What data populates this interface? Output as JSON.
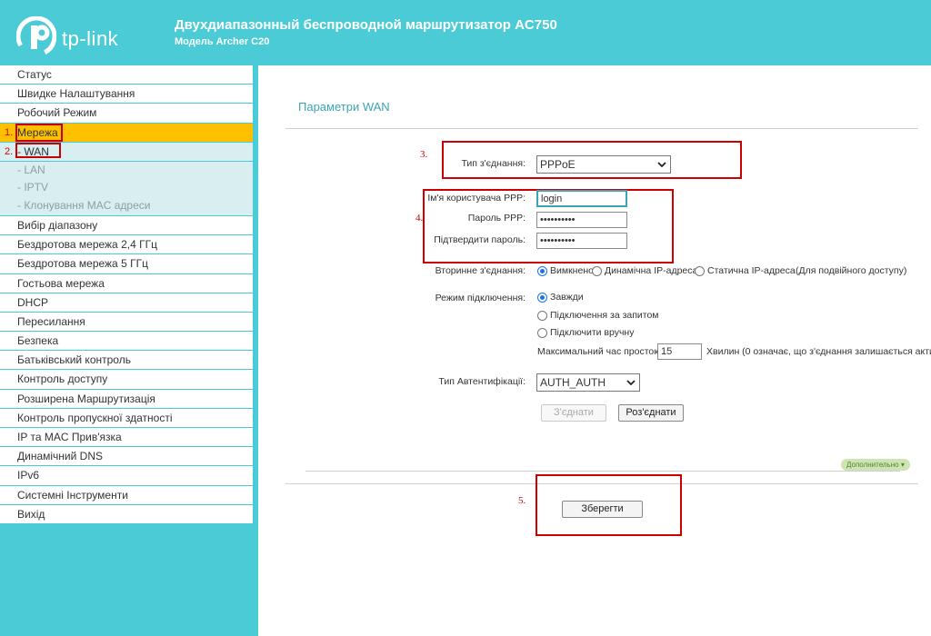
{
  "header": {
    "brand": "tp-link",
    "title": "Двухдиапазонный беспроводной маршрутизатор AC750",
    "model": "Модель Archer C20"
  },
  "sidebar": {
    "items": [
      {
        "label": "Статус"
      },
      {
        "label": "Швидке Налаштування"
      },
      {
        "label": "Робочий Режим"
      },
      {
        "label": "Мережа",
        "marker": "1."
      },
      {
        "label": "- WAN",
        "marker": "2."
      },
      {
        "label": "- LAN"
      },
      {
        "label": "- IPTV"
      },
      {
        "label": "- Клонування MAC адреси"
      },
      {
        "label": "Вибір діапазону"
      },
      {
        "label": "Бездротова мережа 2,4 ГГц"
      },
      {
        "label": "Бездротова мережа 5 ГГц"
      },
      {
        "label": "Гостьова мережа"
      },
      {
        "label": "DHCP"
      },
      {
        "label": "Пересилання"
      },
      {
        "label": "Безпека"
      },
      {
        "label": "Батьківський контроль"
      },
      {
        "label": "Контроль доступу"
      },
      {
        "label": "Розширена Маршрутизація"
      },
      {
        "label": "Контроль пропускної здатності"
      },
      {
        "label": "IP та MAC Прив'язка"
      },
      {
        "label": "Динамічний DNS"
      },
      {
        "label": "IPv6"
      },
      {
        "label": "Системні Інструменти"
      },
      {
        "label": "Вихід"
      }
    ]
  },
  "main": {
    "title": "Параметри WAN",
    "connection_type": {
      "label": "Тип з'єднання:",
      "value": "PPPoE"
    },
    "username": {
      "label": "Ім'я користувача PPP:",
      "value": "login"
    },
    "password": {
      "label": "Пароль PPP:",
      "value": "••••••••••"
    },
    "confirm": {
      "label": "Підтвердити пароль:",
      "value": "••••••••••"
    },
    "secondary": {
      "label": "Вторинне з'єднання:",
      "options": [
        "Вимкнено",
        "Динамічна IP-адреса",
        "Статична IP-адреса",
        "(Для подвійного доступу)"
      ]
    },
    "mode": {
      "label": "Режим підключення:",
      "options": [
        "Завжди",
        "Підключення за запитом",
        "Підключити вручну"
      ],
      "idle_label": "Максимальний час простою:",
      "idle_value": "15",
      "idle_suffix": "Хвилин (0 означає, що з'єднання залишається акти"
    },
    "auth": {
      "label": "Тип Автентифікації:",
      "value": "AUTH_AUTH"
    },
    "connect_label": "З'єднати",
    "disconnect_label": "Роз'єднати",
    "more_label": "Дополнительно",
    "save_label": "Зберегти",
    "markers": {
      "m3": "3.",
      "m4": "4.",
      "m5": "5."
    }
  },
  "colors": {
    "accent": "#4acbd6",
    "active": "#ffc000",
    "annotation": "#cc0000",
    "title": "#3aa5b5"
  }
}
